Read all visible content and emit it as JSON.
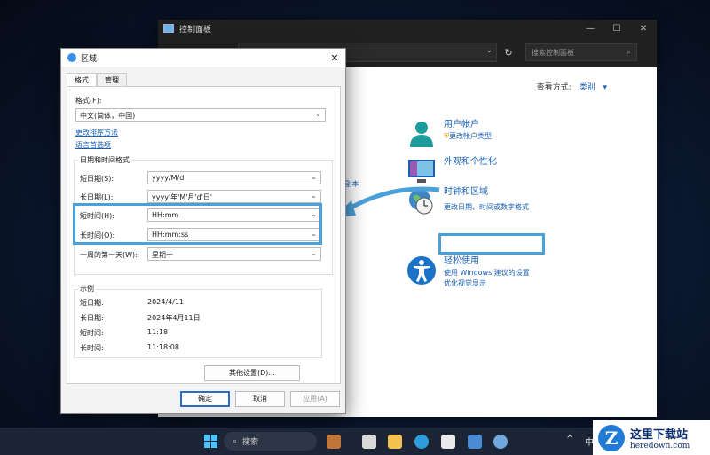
{
  "control_panel": {
    "title": "控制面板",
    "search_placeholder": "搜索控制面板",
    "view_by_label": "查看方式:",
    "view_by_value": "类别",
    "partial_text": "l副本",
    "categories": [
      {
        "title": "用户帐户",
        "links": [
          "更改帐户类型"
        ]
      },
      {
        "title": "外观和个性化",
        "links": []
      },
      {
        "title": "时钟和区域",
        "links": [
          "更改日期、时间或数字格式"
        ]
      },
      {
        "title": "轻松使用",
        "links": [
          "使用 Windows 建议的设置",
          "优化视觉显示"
        ]
      }
    ]
  },
  "dialog": {
    "title": "区域",
    "tabs": [
      "格式",
      "管理"
    ],
    "format_label": "格式(F):",
    "format_value": "中文(简体，中国)",
    "link_sort": "更改排序方法",
    "link_lang": "语言首选项",
    "group_title": "日期和时间格式",
    "rows": [
      {
        "label": "短日期(S):",
        "value": "yyyy/M/d"
      },
      {
        "label": "长日期(L):",
        "value": "yyyy'年'M'月'd'日'"
      },
      {
        "label": "短时间(H):",
        "value": "HH:mm"
      },
      {
        "label": "长时间(O):",
        "value": "HH:mm:ss"
      },
      {
        "label": "一周的第一天(W):",
        "value": "星期一"
      }
    ],
    "examples_title": "示例",
    "examples": [
      {
        "label": "短日期:",
        "value": "2024/4/11"
      },
      {
        "label": "长日期:",
        "value": "2024年4月11日"
      },
      {
        "label": "短时间:",
        "value": "11:18"
      },
      {
        "label": "长时间:",
        "value": "11:18:08"
      }
    ],
    "other_settings": "其他设置(D)...",
    "ok": "确定",
    "cancel": "取消",
    "apply": "应用(A)"
  },
  "taskbar": {
    "search_label": "搜索",
    "ime": "中"
  },
  "watermark": {
    "cn": "这里下载站",
    "en": "heredown.com"
  },
  "colors": {
    "highlight": "#4ca0d9",
    "link": "#1a5fb4"
  }
}
